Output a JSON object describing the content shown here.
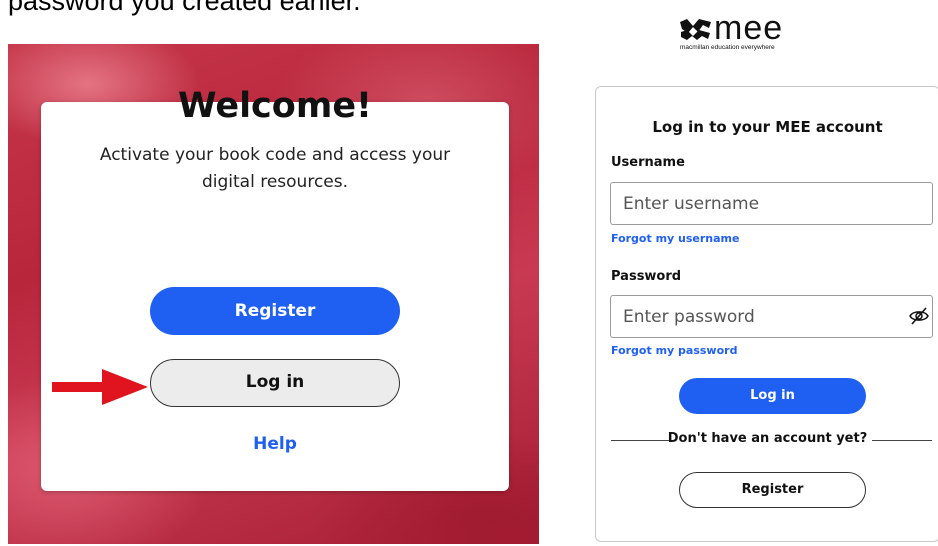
{
  "caption": "password you created earlier.",
  "welcome": {
    "title": "Welcome!",
    "text": "Activate your book code and access your digital resources.",
    "register_label": "Register",
    "login_label": "Log in",
    "help_label": "Help"
  },
  "brand": {
    "name": "mee",
    "tagline": "macmillan education everywhere"
  },
  "login": {
    "title": "Log in to your MEE account",
    "username_label": "Username",
    "username_placeholder": "Enter username",
    "forgot_username": "Forgot my username",
    "password_label": "Password",
    "password_placeholder": "Enter password",
    "forgot_password": "Forgot my password",
    "login_button": "Log in",
    "no_account_text": "Don't have an account yet?",
    "register_button": "Register"
  },
  "icons": {
    "arrow": "red-arrow-icon",
    "eye": "eye-slash-icon",
    "logo": "mee-logo-icon"
  },
  "colors": {
    "primary_blue": "#1f5ff2",
    "brand_red": "#b8263c",
    "arrow_red": "#e0141e"
  }
}
